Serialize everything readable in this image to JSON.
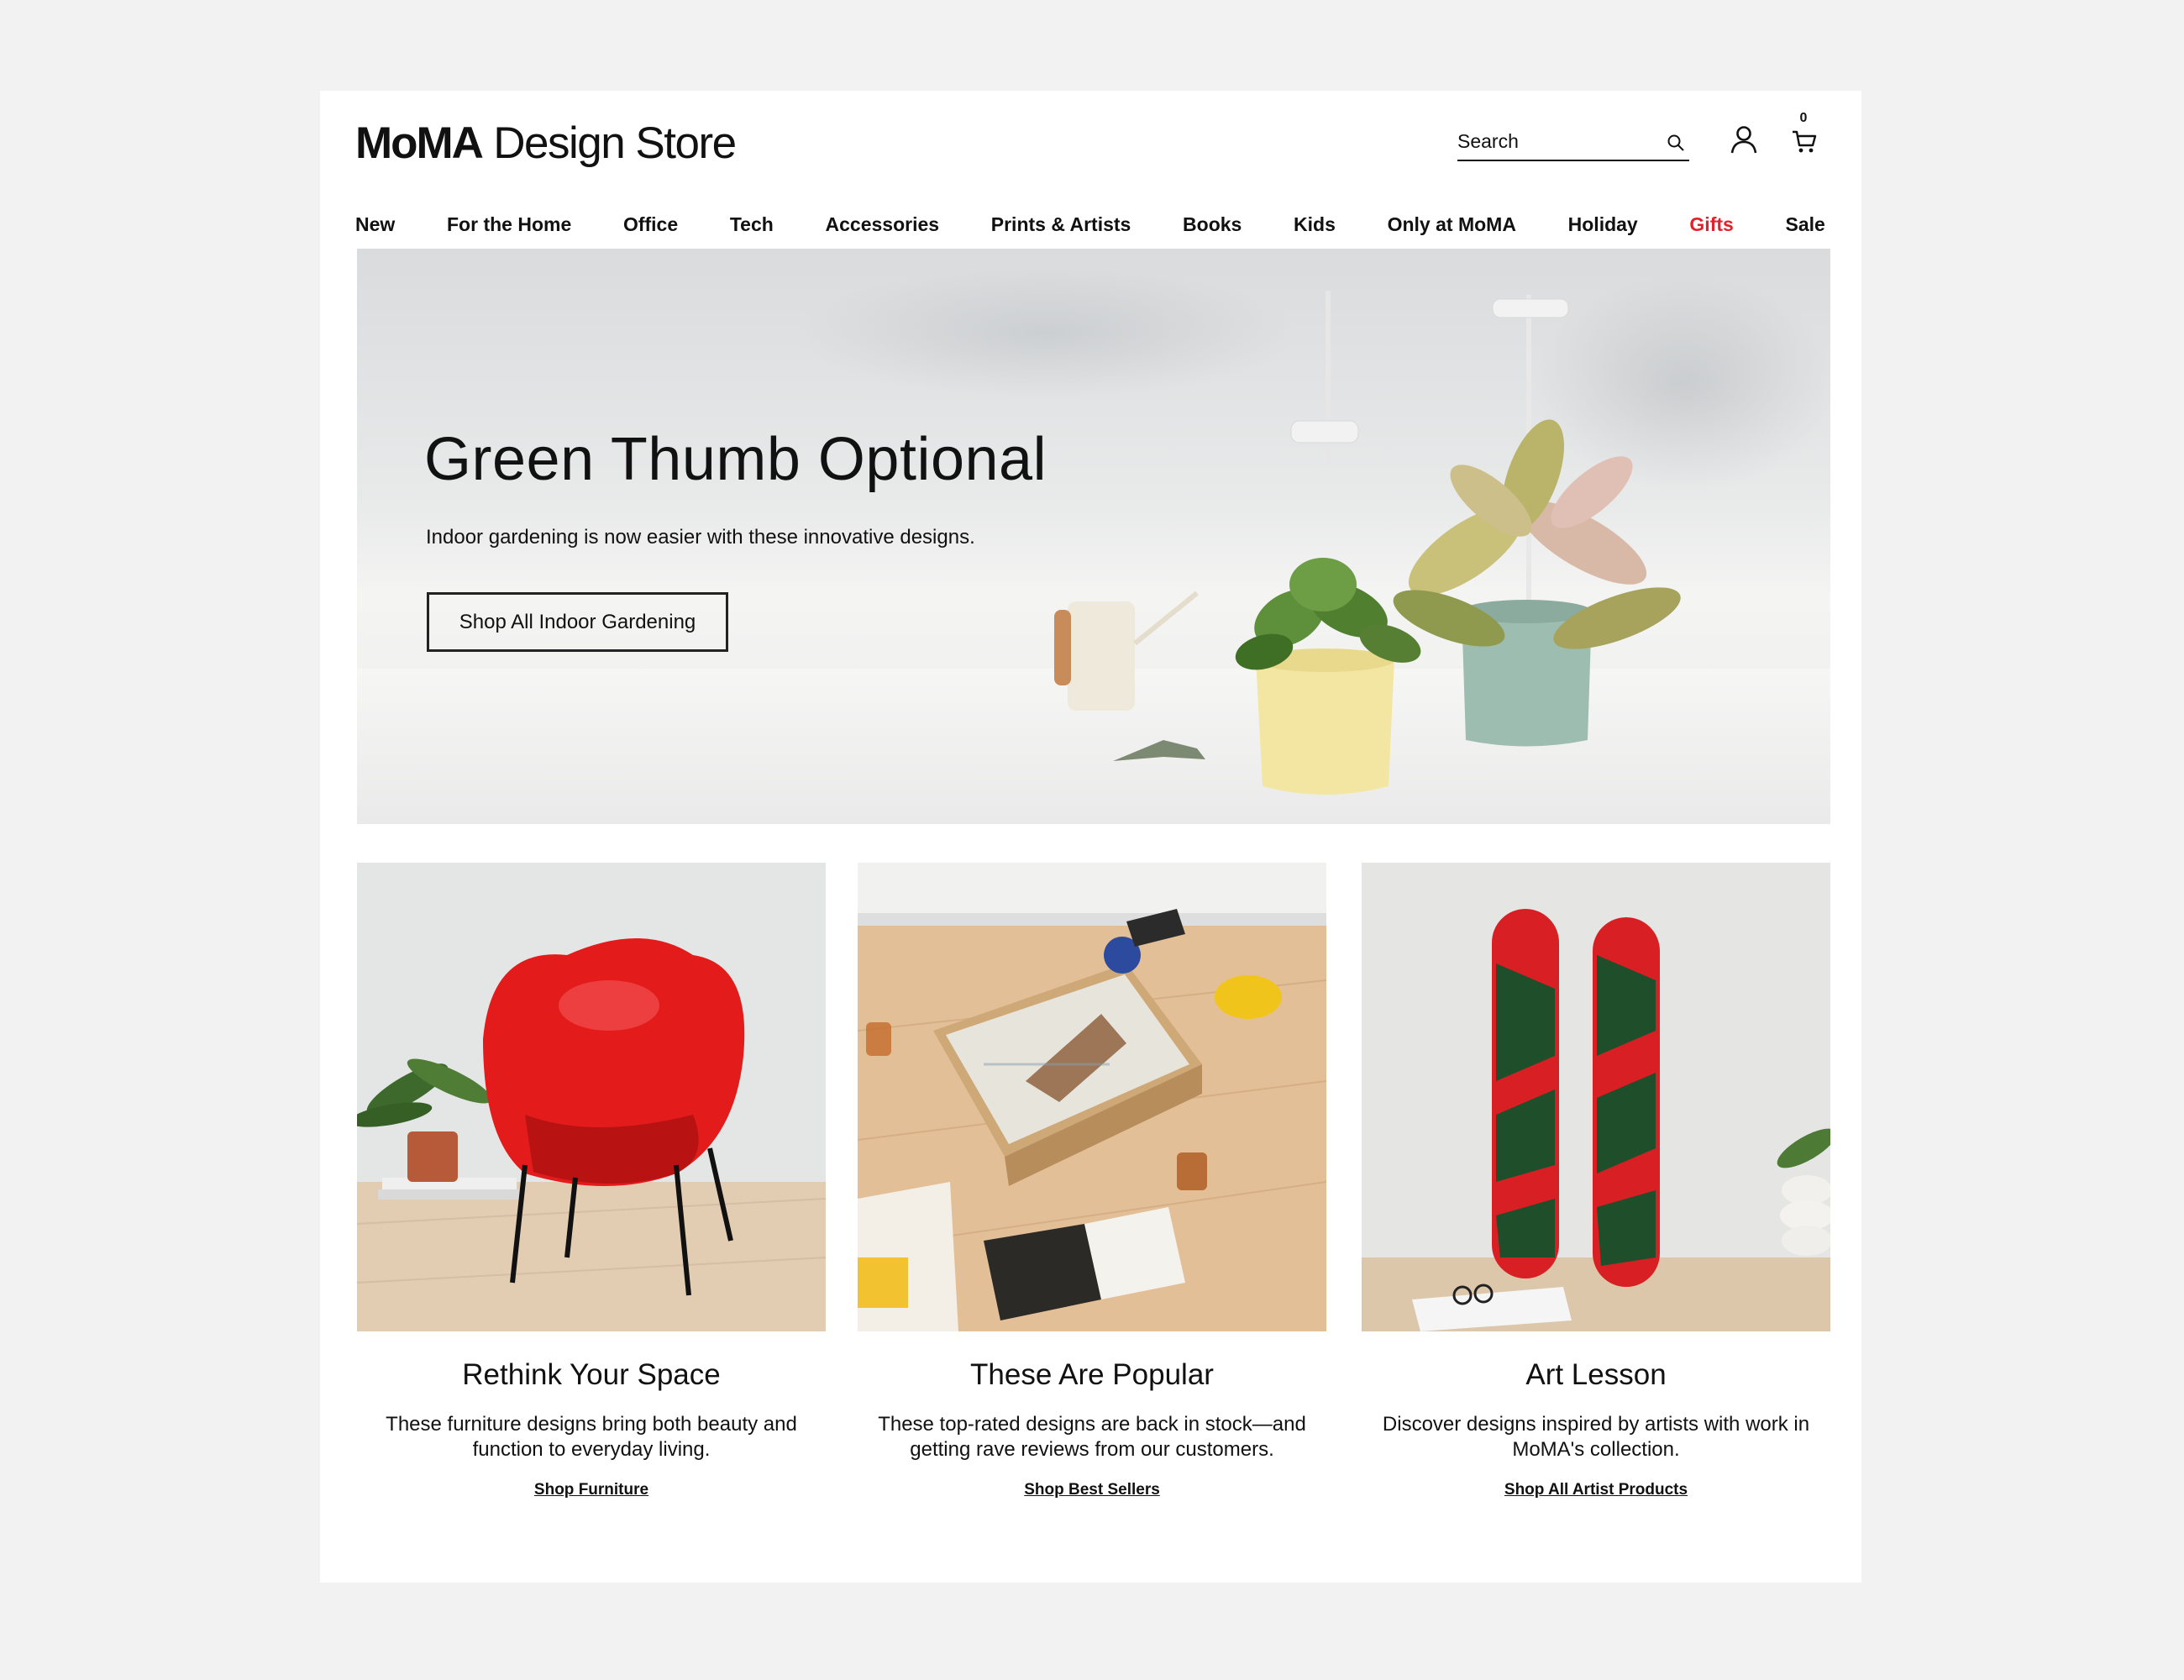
{
  "header": {
    "logo_brand": "MoMA",
    "logo_sub": "Design Store",
    "search_placeholder": "Search",
    "cart_count": "0"
  },
  "nav": {
    "items": [
      "New",
      "For the Home",
      "Office",
      "Tech",
      "Accessories",
      "Prints & Artists",
      "Books",
      "Kids",
      "Only at MoMA",
      "Holiday",
      "Gifts",
      "Sale"
    ],
    "accent_item": "Gifts",
    "accent_color": "#e4202a"
  },
  "hero": {
    "title": "Green Thumb Optional",
    "subtitle": "Indoor gardening is now easier with these innovative designs.",
    "button_label": "Shop All Indoor Gardening"
  },
  "cards": [
    {
      "title": "Rethink Your Space",
      "description": "These furniture designs bring both beauty and function to everyday living.",
      "link": "Shop Furniture"
    },
    {
      "title": "These Are Popular",
      "description": "These top-rated designs are back in stock—and getting rave reviews from our customers.",
      "link": "Shop Best Sellers"
    },
    {
      "title": "Art Lesson",
      "description": "Discover designs inspired by artists with work in MoMA's collection.",
      "link": "Shop All Artist Products"
    }
  ],
  "icons": {
    "search": "search-icon",
    "account": "user-icon",
    "cart": "cart-icon"
  }
}
